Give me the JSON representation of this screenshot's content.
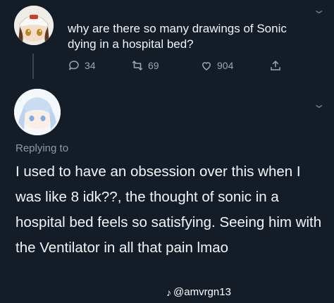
{
  "tweet": {
    "text": "why are there so many drawings of Sonic dying in a hospital bed?",
    "replies": "34",
    "retweets": "69",
    "likes": "904"
  },
  "reply": {
    "replying_label": "Replying to",
    "text": "I used to have an obsession over this when I was like 8 idk??, the thought of sonic in a hospital bed feels so satisfying. Seeing him with the Ventilator in all that pain lmao"
  },
  "watermark": {
    "note_glyph": "♪",
    "handle": "@amvrgn13"
  },
  "colors": {
    "background": "#141c28",
    "text": "#f2f5f8",
    "muted": "#8e9aa7",
    "icon": "#9aa7b4"
  }
}
